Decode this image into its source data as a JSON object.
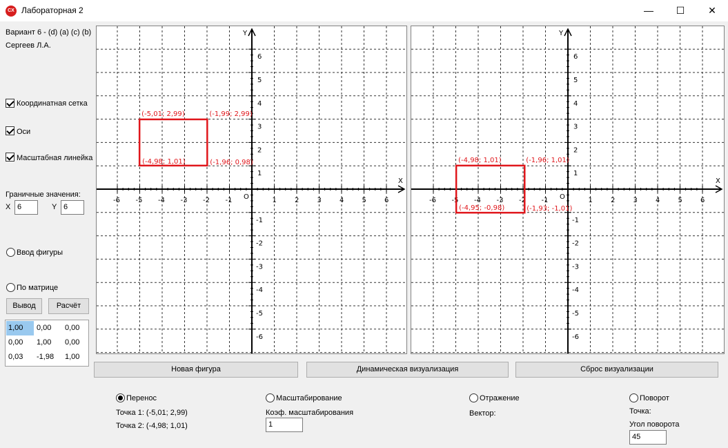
{
  "window": {
    "title": "Лабораторная 2",
    "icon_text": "CX",
    "minimize": "—",
    "maximize": "☐",
    "close": "✕"
  },
  "left": {
    "variant": "Вариант 6 - (d) (a) (c) (b)",
    "author": "Сергеев Л.А.",
    "chk_grid": "Координатная сетка",
    "chk_axes": "Оси",
    "chk_ruler": "Масштабная линейка",
    "limits_label": "Граничные значения:",
    "x_label": "X",
    "x_value": "6",
    "y_label": "Y",
    "y_value": "6",
    "radio_input": "Ввод фигуры",
    "radio_matrix": "По матрице",
    "btn_output": "Вывод",
    "btn_calc": "Расчёт",
    "matrix": [
      [
        "1,00",
        "0,00",
        "0,00"
      ],
      [
        "0,00",
        "1,00",
        "0,00"
      ],
      [
        "0,03",
        "-1,98",
        "1,00"
      ]
    ]
  },
  "buttons": {
    "new_figure": "Новая фигура",
    "dynamic": "Динамическая визуализация",
    "reset": "Сброс визуализации"
  },
  "ops": {
    "translate": {
      "label": "Перенос",
      "selected": true,
      "p1": "Точка 1: (-5,01; 2,99)",
      "p2": "Точка 2: (-4,98; 1,01)"
    },
    "scale": {
      "label": "Масштабирование",
      "coef_label": "Коэф. масштабирования",
      "coef_value": "1"
    },
    "reflect": {
      "label": "Отражение",
      "vector_label": "Вектор:"
    },
    "rotate": {
      "label": "Поворот",
      "point_label": "Точка:",
      "angle_label": "Угол поворота",
      "angle_value": "45"
    }
  },
  "plots": {
    "axis_x": "X",
    "axis_y": "Y",
    "origin": "O",
    "ticks": [
      "-6",
      "-5",
      "-4",
      "-3",
      "-2",
      "-1",
      "1",
      "2",
      "3",
      "4",
      "5",
      "6"
    ],
    "accent": "#e0161b",
    "left": {
      "rect": {
        "x1": -5.01,
        "y1": 2.99,
        "x2": -1.99,
        "y2": 1.01
      },
      "labels": [
        {
          "text": "(-5,01; 2,99)",
          "x": -5.01,
          "y": 2.99,
          "pos": "above"
        },
        {
          "text": "(-1,99; 2,99)",
          "x": -1.99,
          "y": 2.99,
          "pos": "above"
        },
        {
          "text": "(-4,98; 1,01)",
          "x": -4.98,
          "y": 1.01,
          "pos": "inside"
        },
        {
          "text": "(-1,96; 0,98)",
          "x": -1.96,
          "y": 0.98,
          "pos": "inside"
        }
      ]
    },
    "right": {
      "rect": {
        "x1": -4.98,
        "y1": 1.01,
        "x2": -1.93,
        "y2": -1.01
      },
      "labels": [
        {
          "text": "(-4,98; 1,01)",
          "x": -4.98,
          "y": 1.01,
          "pos": "above"
        },
        {
          "text": "(-1,96; 1,01)",
          "x": -1.96,
          "y": 1.01,
          "pos": "above"
        },
        {
          "text": "(-4,95; -0,98)",
          "x": -4.95,
          "y": -0.98,
          "pos": "inside"
        },
        {
          "text": "(-1,93; -1,01)",
          "x": -1.93,
          "y": -1.01,
          "pos": "inside"
        }
      ]
    }
  }
}
